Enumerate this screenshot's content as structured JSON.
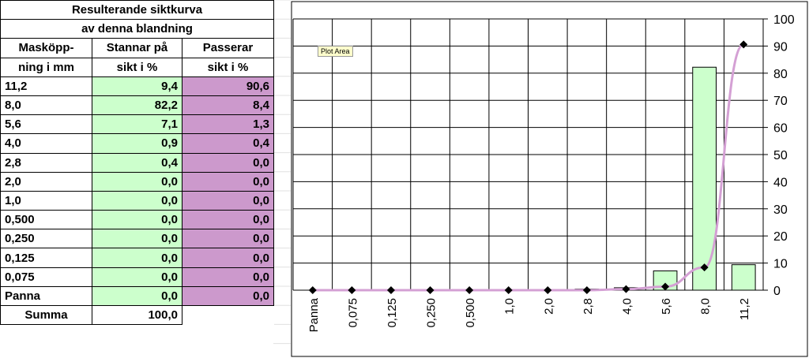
{
  "table": {
    "title1": "Resulterande siktkurva",
    "title2": "av denna blandning",
    "headers": [
      [
        "Masköpp-",
        "Stannar på",
        "Passerar"
      ],
      [
        "ning i mm",
        "sikt i %",
        "sikt i %"
      ]
    ],
    "rows": [
      [
        "11,2",
        "9,4",
        "90,6"
      ],
      [
        "8,0",
        "82,2",
        "8,4"
      ],
      [
        "5,6",
        "7,1",
        "1,3"
      ],
      [
        "4,0",
        "0,9",
        "0,4"
      ],
      [
        "2,8",
        "0,4",
        "0,0"
      ],
      [
        "2,0",
        "0,0",
        "0,0"
      ],
      [
        "1,0",
        "0,0",
        "0,0"
      ],
      [
        "0,500",
        "0,0",
        "0,0"
      ],
      [
        "0,250",
        "0,0",
        "0,0"
      ],
      [
        "0,125",
        "0,0",
        "0,0"
      ],
      [
        "0,075",
        "0,0",
        "0,0"
      ],
      [
        "Panna",
        "0,0",
        "0,0"
      ]
    ],
    "sum_label": "Summa",
    "sum_value": "100,0"
  },
  "tooltip": "Plot Area",
  "colors": {
    "retained": "#ccffcc",
    "passing": "#cc99cc",
    "curve": "#d4a0d4",
    "marker": "#000000"
  },
  "chart_data": {
    "type": "bar",
    "categories": [
      "Panna",
      "0,075",
      "0,125",
      "0,250",
      "0,500",
      "1,0",
      "2,0",
      "2,8",
      "4,0",
      "5,6",
      "8,0",
      "11,2"
    ],
    "series": [
      {
        "type": "bar",
        "values": [
          0,
          0,
          0,
          0,
          0,
          0,
          0,
          0.4,
          0.9,
          7.1,
          82.2,
          9.4
        ]
      },
      {
        "type": "line",
        "values": [
          0,
          0,
          0,
          0,
          0,
          0,
          0,
          0,
          0.4,
          1.3,
          8.4,
          90.6
        ]
      }
    ],
    "ylim": [
      0,
      100
    ],
    "yticks": [
      "0",
      "10",
      "20",
      "30",
      "40",
      "50",
      "60",
      "70",
      "80",
      "90",
      "100"
    ],
    "y_axis_position": "right",
    "grid": true
  }
}
